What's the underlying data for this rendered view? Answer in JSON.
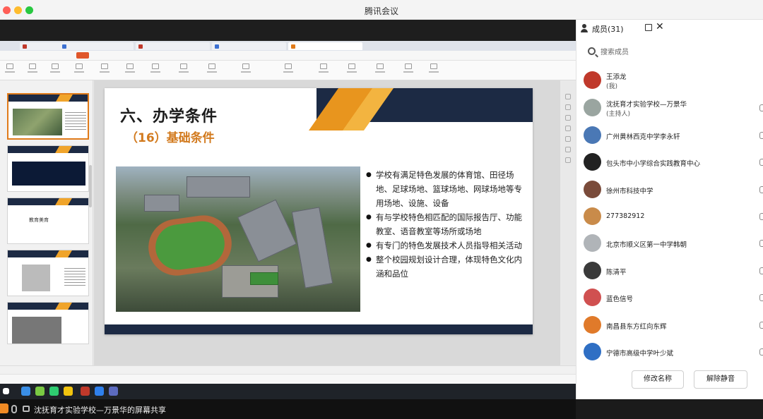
{
  "app": {
    "title": "腾讯会议"
  },
  "share": {
    "caption": "沈抚育才实验学校—万景华的屏幕共享"
  },
  "slide": {
    "title": "六、办学条件",
    "subtitle": "（16）基础条件",
    "bullets": [
      "学校有满足特色发展的体育馆、田径场地、足球场地、篮球场地、网球场地等专用场地、设施、设备",
      "有与学校特色相匹配的国际报告厅、功能教室、语音教室等场所或场地",
      "有专门的特色发展技术人员指导相关活动",
      "整个校园规划设计合理，体现特色文化内涵和品位"
    ]
  },
  "thumbnail_slide": {
    "title": "教育美育"
  },
  "members_panel": {
    "title": "成员(31)",
    "search_placeholder": "搜索成员",
    "members": [
      {
        "name": "王添龙",
        "role": "(我)",
        "avatar_color": "#c0392b"
      },
      {
        "name": "沈抚育才实验学校—万景华",
        "role": "(主持人)",
        "avatar_color": "#9aa5a0"
      },
      {
        "name": "广州黄林西克中学李永轩",
        "role": "",
        "avatar_color": "#4a78b5"
      },
      {
        "name": "包头市中小学综合实践教育中心",
        "role": "",
        "avatar_color": "#222222"
      },
      {
        "name": "徐州市科技中学",
        "role": "",
        "avatar_color": "#7a4b3a"
      },
      {
        "name": "277382912",
        "role": "",
        "avatar_color": "#c98b4a"
      },
      {
        "name": "北京市顺义区第一中学韩朝",
        "role": "",
        "avatar_color": "#b0b4b8"
      },
      {
        "name": "陈清平",
        "role": "",
        "avatar_color": "#3a3a3a"
      },
      {
        "name": "蓝色信号",
        "role": "",
        "avatar_color": "#d05050"
      },
      {
        "name": "南昌县东方红向东辉",
        "role": "",
        "avatar_color": "#e07a2a"
      },
      {
        "name": "宁德市高级中学叶少斌",
        "role": "",
        "avatar_color": "#2f6fc4"
      }
    ],
    "rename_button": "修改名称",
    "unmute_button": "解除静音"
  }
}
